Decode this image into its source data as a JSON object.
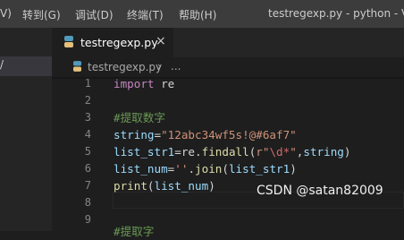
{
  "menubar": {
    "partial_item": "V)",
    "items": [
      "转到(G)",
      "调试(D)",
      "终端(T)",
      "帮助(H)"
    ],
    "title": "testregexp.py - python - Visu"
  },
  "sidebar": {
    "partial_label": "/"
  },
  "tab": {
    "filename": "testregexp.py",
    "close": "×",
    "icon": "python-file-icon"
  },
  "breadcrumb": {
    "filename": "testregexp.py",
    "separator": "›",
    "more": "..."
  },
  "editor": {
    "line_numbers": [
      "1",
      "2",
      "3",
      "4",
      "5",
      "6",
      "7",
      "8",
      "9"
    ],
    "lines": {
      "l1": [
        "import",
        " re"
      ],
      "l3": [
        "#提取数字"
      ],
      "l4": [
        "string",
        "=",
        "\"12abc34wf5s!@#6af7\""
      ],
      "l5": [
        "list_str1",
        "=",
        "re",
        ".",
        "findall",
        "(",
        "r\"",
        "\\d*",
        "\"",
        ",",
        "string",
        ")"
      ],
      "l6": [
        "list_num",
        "=",
        "''",
        ".",
        "join",
        "(",
        "list_str1",
        ")"
      ],
      "l7": [
        "print",
        "(",
        "list_num",
        ")"
      ],
      "l9": [
        "#提取字"
      ]
    }
  },
  "watermark": "CSDN @satan82009",
  "colors": {
    "titlebar": "#3c3c3c",
    "editor_bg": "#1e1e1e",
    "keyword": "#c586c0",
    "comment": "#6a9955",
    "string": "#ce9178",
    "variable": "#9cdcfe",
    "function": "#dcdcaa",
    "python_icon": "#519aba"
  }
}
